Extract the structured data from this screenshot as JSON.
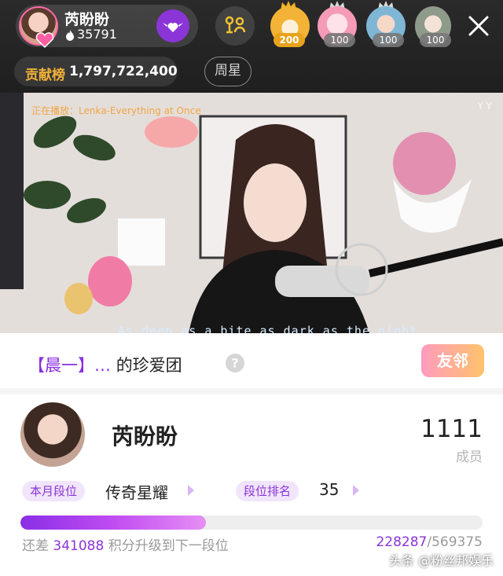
{
  "host": {
    "name": "芮盼盼",
    "fans": "35791"
  },
  "viewers": [
    {
      "badge": "200"
    },
    {
      "badge": "100"
    },
    {
      "badge": "100"
    },
    {
      "badge": "100"
    }
  ],
  "contribution": {
    "label": "贡献榜",
    "value": "1,797,722,400"
  },
  "week_star_label": "周星",
  "stream": {
    "now_playing": "正在播放：Lenka-Everything at Once",
    "corner_text": "Y Y",
    "lyrics": "As deep as a bite as dark as the night"
  },
  "fan_group": {
    "prefix": "【晨一】…",
    "title": "的珍爱团",
    "neighbor_label": "友邻"
  },
  "card": {
    "name": "芮盼盼",
    "member_count": "1111",
    "member_label": "成员",
    "month_tier_tag": "本月段位",
    "month_tier_value": "传奇星耀",
    "rank_tag": "段位排名",
    "rank_value": "35"
  },
  "progress": {
    "fraction": 0.401,
    "prefix": "还差",
    "needed": "341088",
    "suffix": "积分升级到下一段位",
    "current": "228287",
    "total": "/569375"
  },
  "watermark": "头条 @粉丝邦娱乐",
  "colors": {
    "accent_purple": "#8a34d8",
    "gold": "#f2b23a"
  }
}
